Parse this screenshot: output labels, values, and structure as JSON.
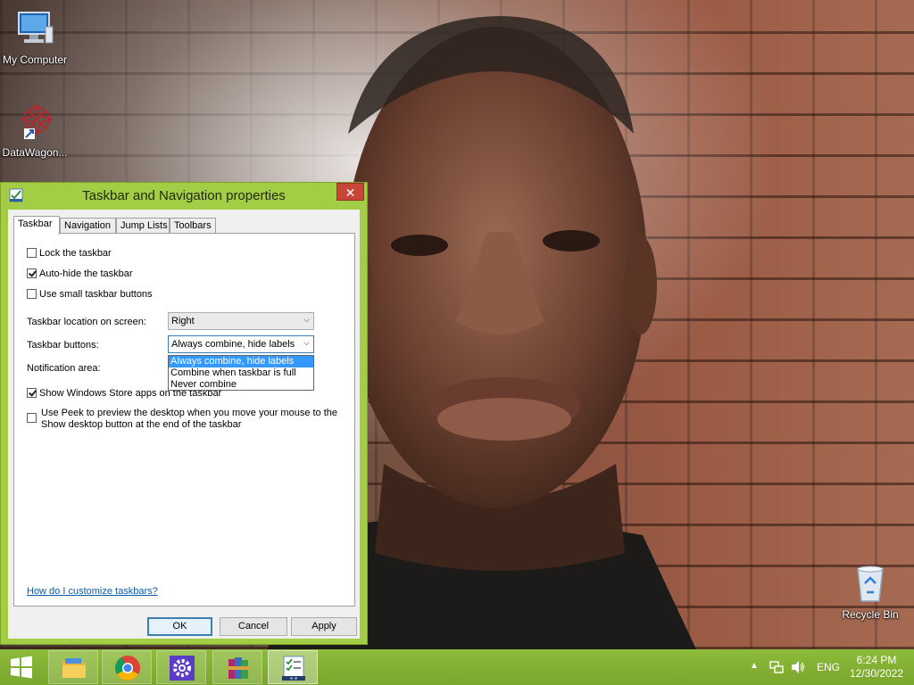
{
  "desktop": {
    "icons": [
      {
        "label": "My Computer"
      },
      {
        "label": "DataWagon..."
      },
      {
        "label": "Recycle Bin"
      }
    ]
  },
  "dialog": {
    "title": "Taskbar and Navigation properties",
    "close": "✕",
    "tabs": [
      "Taskbar",
      "Navigation",
      "Jump Lists",
      "Toolbars"
    ],
    "active_tab": "Taskbar",
    "options": {
      "lock": {
        "label": "Lock the taskbar",
        "checked": false
      },
      "autohide": {
        "label": "Auto-hide the taskbar",
        "checked": true
      },
      "small": {
        "label": "Use small taskbar buttons",
        "checked": false
      },
      "store": {
        "label": "Show Windows Store apps on the taskbar",
        "checked": true
      },
      "peek": {
        "label_line1": "Use Peek to preview the desktop when you move your mouse to the",
        "label_line2": "Show desktop button at the end of the taskbar",
        "checked": false
      }
    },
    "location": {
      "label": "Taskbar location on screen:",
      "value": "Right"
    },
    "buttons_combo": {
      "label": "Taskbar buttons:",
      "value": "Always combine, hide labels",
      "options": [
        "Always combine, hide labels",
        "Combine when taskbar is full",
        "Never combine"
      ],
      "selected": "Always combine, hide labels"
    },
    "notification": {
      "label": "Notification area:"
    },
    "help_link": "How do I customize taskbars?",
    "ok": "OK",
    "cancel": "Cancel",
    "apply": "Apply"
  },
  "taskbar": {
    "color": "#86b536",
    "apps": [
      "start-icon",
      "file-explorer-icon",
      "chrome-icon",
      "settings-icon",
      "winrar-icon",
      "properties-window-icon"
    ],
    "tray": {
      "language": "ENG",
      "time": "6:24 PM",
      "date": "12/30/2022"
    }
  }
}
